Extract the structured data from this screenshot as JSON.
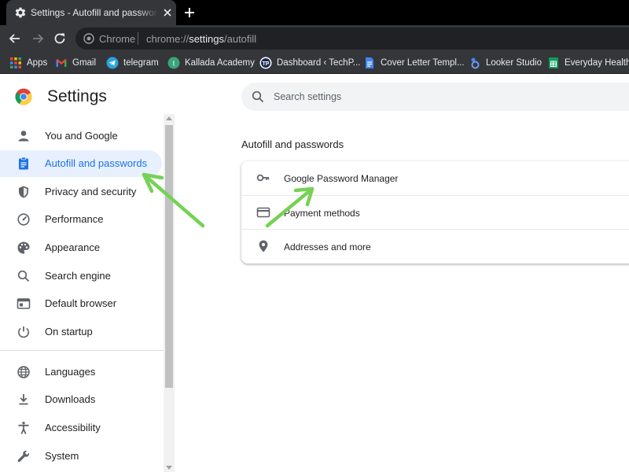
{
  "browser": {
    "tab": {
      "title": "Settings - Autofill and passwords",
      "icon": "gear-icon"
    },
    "omnibox": {
      "scheme_label": "Chrome",
      "url_prefix": "chrome://",
      "url_host": "settings",
      "url_path": "/autofill"
    },
    "bookmarks": [
      {
        "label": "Apps",
        "icon": "apps-grid-icon"
      },
      {
        "label": "Gmail",
        "icon": "gmail-icon"
      },
      {
        "label": "telegram",
        "icon": "telegram-icon"
      },
      {
        "label": "Kallada Academy",
        "icon": "kallada-academy-icon"
      },
      {
        "label": "Dashboard ‹ TechP...",
        "icon": "techpp-icon"
      },
      {
        "label": "Cover Letter Templ...",
        "icon": "google-docs-icon"
      },
      {
        "label": "Looker Studio",
        "icon": "looker-studio-icon"
      },
      {
        "label": "Everyday Health T",
        "icon": "google-sheets-icon"
      }
    ]
  },
  "settings": {
    "title": "Settings",
    "search_placeholder": "Search settings",
    "sidebar": [
      {
        "label": "You and Google",
        "icon": "person-icon",
        "active": false
      },
      {
        "label": "Autofill and passwords",
        "icon": "clipboard-icon",
        "active": true
      },
      {
        "label": "Privacy and security",
        "icon": "shield-icon",
        "active": false
      },
      {
        "label": "Performance",
        "icon": "speedometer-icon",
        "active": false
      },
      {
        "label": "Appearance",
        "icon": "palette-icon",
        "active": false
      },
      {
        "label": "Search engine",
        "icon": "search-icon",
        "active": false
      },
      {
        "label": "Default browser",
        "icon": "browser-window-icon",
        "active": false
      },
      {
        "label": "On startup",
        "icon": "power-icon",
        "active": false
      },
      {
        "label": "Languages",
        "icon": "globe-icon",
        "active": false
      },
      {
        "label": "Downloads",
        "icon": "download-icon",
        "active": false
      },
      {
        "label": "Accessibility",
        "icon": "accessibility-icon",
        "active": false
      },
      {
        "label": "System",
        "icon": "wrench-icon",
        "active": false
      }
    ],
    "section": {
      "title": "Autofill and passwords",
      "rows": [
        {
          "label": "Google Password Manager",
          "icon": "key-icon"
        },
        {
          "label": "Payment methods",
          "icon": "credit-card-icon"
        },
        {
          "label": "Addresses and more",
          "icon": "location-pin-icon"
        }
      ]
    }
  },
  "colors": {
    "accent": "#1a73e8",
    "active_bg": "#e8f0fe",
    "annotation_arrow": "#76d155"
  }
}
